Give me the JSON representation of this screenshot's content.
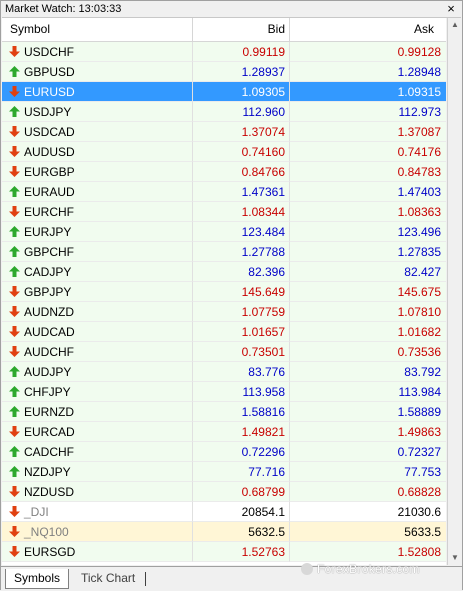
{
  "window": {
    "title": "Market Watch: 13:03:33",
    "close_glyph": "×"
  },
  "columns": {
    "symbol": "Symbol",
    "bid": "Bid",
    "ask": "Ask"
  },
  "rows": [
    {
      "symbol": "USDCHF",
      "bid": "0.99119",
      "ask": "0.99128",
      "dir": "down",
      "state": "normal"
    },
    {
      "symbol": "GBPUSD",
      "bid": "1.28937",
      "ask": "1.28948",
      "dir": "up",
      "state": "normal"
    },
    {
      "symbol": "EURUSD",
      "bid": "1.09305",
      "ask": "1.09315",
      "dir": "down",
      "state": "selected"
    },
    {
      "symbol": "USDJPY",
      "bid": "112.960",
      "ask": "112.973",
      "dir": "up",
      "state": "normal"
    },
    {
      "symbol": "USDCAD",
      "bid": "1.37074",
      "ask": "1.37087",
      "dir": "down",
      "state": "normal"
    },
    {
      "symbol": "AUDUSD",
      "bid": "0.74160",
      "ask": "0.74176",
      "dir": "down",
      "state": "normal"
    },
    {
      "symbol": "EURGBP",
      "bid": "0.84766",
      "ask": "0.84783",
      "dir": "down",
      "state": "normal"
    },
    {
      "symbol": "EURAUD",
      "bid": "1.47361",
      "ask": "1.47403",
      "dir": "up",
      "state": "normal"
    },
    {
      "symbol": "EURCHF",
      "bid": "1.08344",
      "ask": "1.08363",
      "dir": "down",
      "state": "normal"
    },
    {
      "symbol": "EURJPY",
      "bid": "123.484",
      "ask": "123.496",
      "dir": "up",
      "state": "normal"
    },
    {
      "symbol": "GBPCHF",
      "bid": "1.27788",
      "ask": "1.27835",
      "dir": "up",
      "state": "normal"
    },
    {
      "symbol": "CADJPY",
      "bid": "82.396",
      "ask": "82.427",
      "dir": "up",
      "state": "normal"
    },
    {
      "symbol": "GBPJPY",
      "bid": "145.649",
      "ask": "145.675",
      "dir": "down",
      "state": "normal"
    },
    {
      "symbol": "AUDNZD",
      "bid": "1.07759",
      "ask": "1.07810",
      "dir": "down",
      "state": "normal"
    },
    {
      "symbol": "AUDCAD",
      "bid": "1.01657",
      "ask": "1.01682",
      "dir": "down",
      "state": "normal"
    },
    {
      "symbol": "AUDCHF",
      "bid": "0.73501",
      "ask": "0.73536",
      "dir": "down",
      "state": "normal"
    },
    {
      "symbol": "AUDJPY",
      "bid": "83.776",
      "ask": "83.792",
      "dir": "up",
      "state": "normal"
    },
    {
      "symbol": "CHFJPY",
      "bid": "113.958",
      "ask": "113.984",
      "dir": "up",
      "state": "normal"
    },
    {
      "symbol": "EURNZD",
      "bid": "1.58816",
      "ask": "1.58889",
      "dir": "up",
      "state": "normal"
    },
    {
      "symbol": "EURCAD",
      "bid": "1.49821",
      "ask": "1.49863",
      "dir": "down",
      "state": "normal"
    },
    {
      "symbol": "CADCHF",
      "bid": "0.72296",
      "ask": "0.72327",
      "dir": "up",
      "state": "normal"
    },
    {
      "symbol": "NZDJPY",
      "bid": "77.716",
      "ask": "77.753",
      "dir": "up",
      "state": "normal"
    },
    {
      "symbol": "NZDUSD",
      "bid": "0.68799",
      "ask": "0.68828",
      "dir": "down",
      "state": "normal"
    },
    {
      "symbol": "_DJI",
      "bid": "20854.1",
      "ask": "21030.6",
      "dir": "down",
      "state": "plain"
    },
    {
      "symbol": "_NQ100",
      "bid": "5632.5",
      "ask": "5633.5",
      "dir": "down",
      "state": "warn"
    },
    {
      "symbol": "EURSGD",
      "bid": "1.52763",
      "ask": "1.52808",
      "dir": "down",
      "state": "normal"
    }
  ],
  "colors": {
    "up": "#0000c8",
    "down": "#c80000",
    "arrow_up": "#2ca82c",
    "arrow_down": "#e04010",
    "selected": "#3399ff"
  },
  "icons": {
    "up": "green-up-arrow-icon",
    "down": "red-down-arrow-icon"
  },
  "tabs": {
    "symbols": "Symbols",
    "tick_chart": "Tick Chart"
  },
  "watermark": "ForexBrokers.com"
}
